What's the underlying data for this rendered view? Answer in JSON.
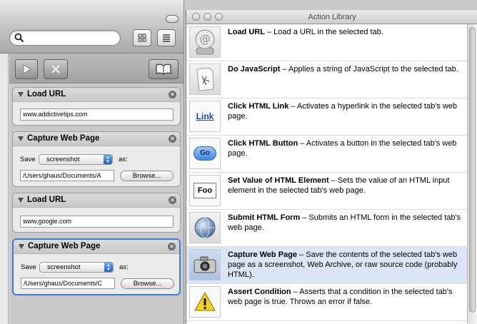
{
  "right_window": {
    "title": "Action Library"
  },
  "workflow": {
    "cards": [
      {
        "title": "Load URL",
        "url": "www.addictivetips.com"
      },
      {
        "title": "Capture Web Page",
        "save_label": "Save",
        "format": "screenshot",
        "as_label": "as:",
        "path": "/Users/ghaus/Documents/A",
        "browse_label": "Browse..."
      },
      {
        "title": "Load URL",
        "url": "www.google.com"
      },
      {
        "title": "Capture Web Page",
        "save_label": "Save",
        "format": "screenshot",
        "as_label": "as:",
        "path": "/Users/ghaus/Documents/C",
        "browse_label": "Browse..."
      }
    ]
  },
  "library": {
    "items": [
      {
        "name": "Load URL",
        "desc": " – Load a URL in the selected tab.",
        "icon": "at-sign-icon"
      },
      {
        "name": "Do JavaScript",
        "desc": " – Applies a string of JavaScript to the selected tab.",
        "icon": "script-icon"
      },
      {
        "name": "Click HTML Link",
        "desc": " – Activates a hyperlink in the selected tab's web page.",
        "icon_text": "Link"
      },
      {
        "name": "Click HTML Button",
        "desc": " – Activates a button in the selected tab's web page.",
        "icon_text": "Go"
      },
      {
        "name": "Set Value of HTML Element",
        "desc": " – Sets the value of an HTML input element in the selected tab's web page.",
        "icon_text": "Foo"
      },
      {
        "name": "Submit HTML Form",
        "desc": " – Submits an HTML form in the selected tab's web page.",
        "icon": "globe-icon"
      },
      {
        "name": "Capture Web Page",
        "desc": " – Save the contents of the selected tab's web page as a screenshot, Web Archive, or raw source code (probably HTML).",
        "icon": "camera-icon"
      },
      {
        "name": "Assert Condition",
        "desc": " – Asserts that a condition in the selected tab's web page is true. Throws an error if false.",
        "icon": "warning-icon"
      }
    ],
    "selected_index": 6
  },
  "colors": {
    "selection_blue": "#3d7fd6",
    "row_selected": "#dbe6f6"
  }
}
